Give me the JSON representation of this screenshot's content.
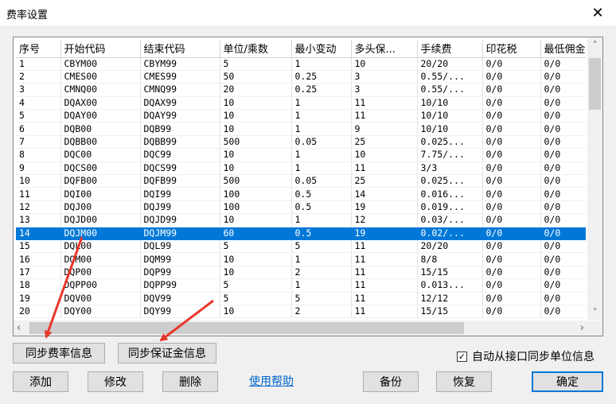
{
  "window": {
    "title": "费率设置",
    "close_label": "✕"
  },
  "grid": {
    "columns": [
      "序号",
      "开始代码",
      "结束代码",
      "单位/乘数",
      "最小变动",
      "多头保...",
      "手续费",
      "印花税",
      "最低佣金"
    ],
    "column_widths": [
      56,
      100,
      100,
      90,
      75,
      83,
      82,
      73,
      60
    ],
    "selected_row_index": 13,
    "rows": [
      [
        "1",
        "CBYM00",
        "CBYM99",
        "5",
        "1",
        "10",
        "20/20",
        "0/0",
        "0/0"
      ],
      [
        "2",
        "CMES00",
        "CMES99",
        "50",
        "0.25",
        "3",
        "0.55/...",
        "0/0",
        "0/0"
      ],
      [
        "3",
        "CMNQ00",
        "CMNQ99",
        "20",
        "0.25",
        "3",
        "0.55/...",
        "0/0",
        "0/0"
      ],
      [
        "4",
        "DQAX00",
        "DQAX99",
        "10",
        "1",
        "11",
        "10/10",
        "0/0",
        "0/0"
      ],
      [
        "5",
        "DQAY00",
        "DQAY99",
        "10",
        "1",
        "11",
        "10/10",
        "0/0",
        "0/0"
      ],
      [
        "6",
        "DQB00",
        "DQB99",
        "10",
        "1",
        "9",
        "10/10",
        "0/0",
        "0/0"
      ],
      [
        "7",
        "DQBB00",
        "DQBB99",
        "500",
        "0.05",
        "25",
        "0.025...",
        "0/0",
        "0/0"
      ],
      [
        "8",
        "DQC00",
        "DQC99",
        "10",
        "1",
        "10",
        "7.75/...",
        "0/0",
        "0/0"
      ],
      [
        "9",
        "DQCS00",
        "DQCS99",
        "10",
        "1",
        "11",
        "3/3",
        "0/0",
        "0/0"
      ],
      [
        "10",
        "DQFB00",
        "DQFB99",
        "500",
        "0.05",
        "25",
        "0.025...",
        "0/0",
        "0/0"
      ],
      [
        "11",
        "DQI00",
        "DQI99",
        "100",
        "0.5",
        "14",
        "0.016...",
        "0/0",
        "0/0"
      ],
      [
        "12",
        "DQJ00",
        "DQJ99",
        "100",
        "0.5",
        "19",
        "0.019...",
        "0/0",
        "0/0"
      ],
      [
        "13",
        "DQJD00",
        "DQJD99",
        "10",
        "1",
        "12",
        "0.03/...",
        "0/0",
        "0/0"
      ],
      [
        "14",
        "DQJM00",
        "DQJM99",
        "60",
        "0.5",
        "19",
        "0.02/...",
        "0/0",
        "0/0"
      ],
      [
        "15",
        "DQL00",
        "DQL99",
        "5",
        "5",
        "11",
        "20/20",
        "0/0",
        "0/0"
      ],
      [
        "16",
        "DQM00",
        "DQM99",
        "10",
        "1",
        "11",
        "8/8",
        "0/0",
        "0/0"
      ],
      [
        "17",
        "DQP00",
        "DQP99",
        "10",
        "2",
        "11",
        "15/15",
        "0/0",
        "0/0"
      ],
      [
        "18",
        "DQPP00",
        "DQPP99",
        "5",
        "1",
        "11",
        "0.013...",
        "0/0",
        "0/0"
      ],
      [
        "19",
        "DQV00",
        "DQV99",
        "5",
        "5",
        "11",
        "12/12",
        "0/0",
        "0/0"
      ],
      [
        "20",
        "DQY00",
        "DQY99",
        "10",
        "2",
        "11",
        "15/15",
        "0/0",
        "0/0"
      ]
    ]
  },
  "scroll": {
    "up": "˄",
    "down": "˅",
    "left": "‹",
    "right": "›"
  },
  "buttons": {
    "sync_fee": "同步费率信息",
    "sync_margin": "同步保证金信息",
    "add": "添加",
    "modify": "修改",
    "delete": "删除",
    "help": "使用帮助",
    "backup": "备份",
    "restore": "恢复",
    "ok": "确定"
  },
  "checkbox": {
    "label": "自动从接口同步单位信息",
    "checked": true,
    "mark": "✓"
  },
  "colors": {
    "selection": "#0078d7",
    "annotation_arrow": "#e8372a",
    "link": "#0066cc"
  }
}
